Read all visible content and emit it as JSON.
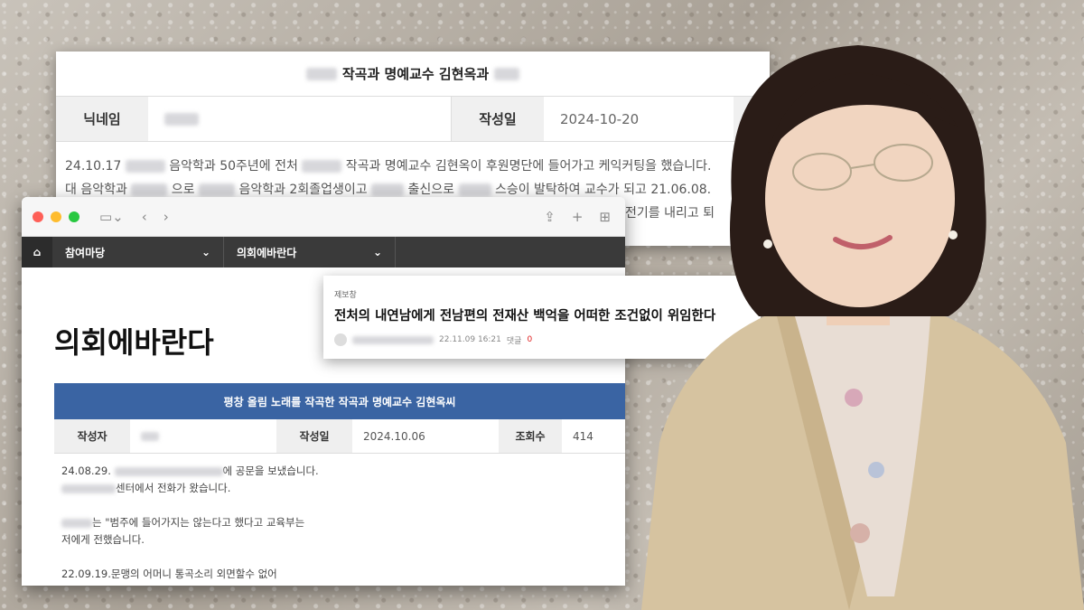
{
  "back_post": {
    "title": "작곡과 명예교수 김현옥과",
    "nickname_label": "닉네임",
    "date_label": "작성일",
    "date_value": "2024-10-20",
    "body_line1_a": "24.10.17",
    "body_line1_b": "음악학과 50주년에 전처",
    "body_line1_c": "작곡과 명예교수 김현옥이 후원명단에 들어가고 케익커팅을 했습니다.",
    "body_line2_a": "대 음악학과",
    "body_line2_b": "으로",
    "body_line2_c": "음악학과 2회졸업생이고",
    "body_line2_d": "출신으로",
    "body_line2_e": "스승이 발탁하여 교수가 되고 21.06.08.",
    "body_line3": "전기를 내리고 퇴"
  },
  "browser": {
    "nav_menu1": "참여마당",
    "nav_menu2": "의회에바란다",
    "page_title": "의회에바란다",
    "post_title": "평창 올림 노래를 작곡한 작곡과 명예교수 김현옥씨",
    "author_label": "작성자",
    "date_label": "작성일",
    "date_value": "2024.10.06",
    "views_label": "조회수",
    "views_value": "414",
    "body": {
      "l1": "24.08.29.",
      "l1b": "에 공문을 보냈습니다.",
      "l2": "센터에서 전화가 왔습니다.",
      "l3": "는 \"범주에 들어가지는 않는다고 했다고 교육부는",
      "l4": "저에게 전했습니다.",
      "l5": "22.09.19.문맹의 어머니 통곡소리 외면할수 없어"
    }
  },
  "comment": {
    "board": "제보창",
    "title": "전처의 내연남에게 전남편의 전재산 백억을 어떠한 조건없이 위임한다",
    "datetime": "22.11.09 16:21",
    "reply_label": "댓글",
    "reply_count": "0"
  },
  "colors": {
    "accent_blue": "#3a64a3",
    "nav_dark": "#3a3a3a",
    "reply_red": "#e02020"
  },
  "icons": [
    "home-icon",
    "sidebar-icon",
    "back-icon",
    "forward-icon",
    "share-icon",
    "plus-icon",
    "grid-icon",
    "chevron-down-icon"
  ]
}
